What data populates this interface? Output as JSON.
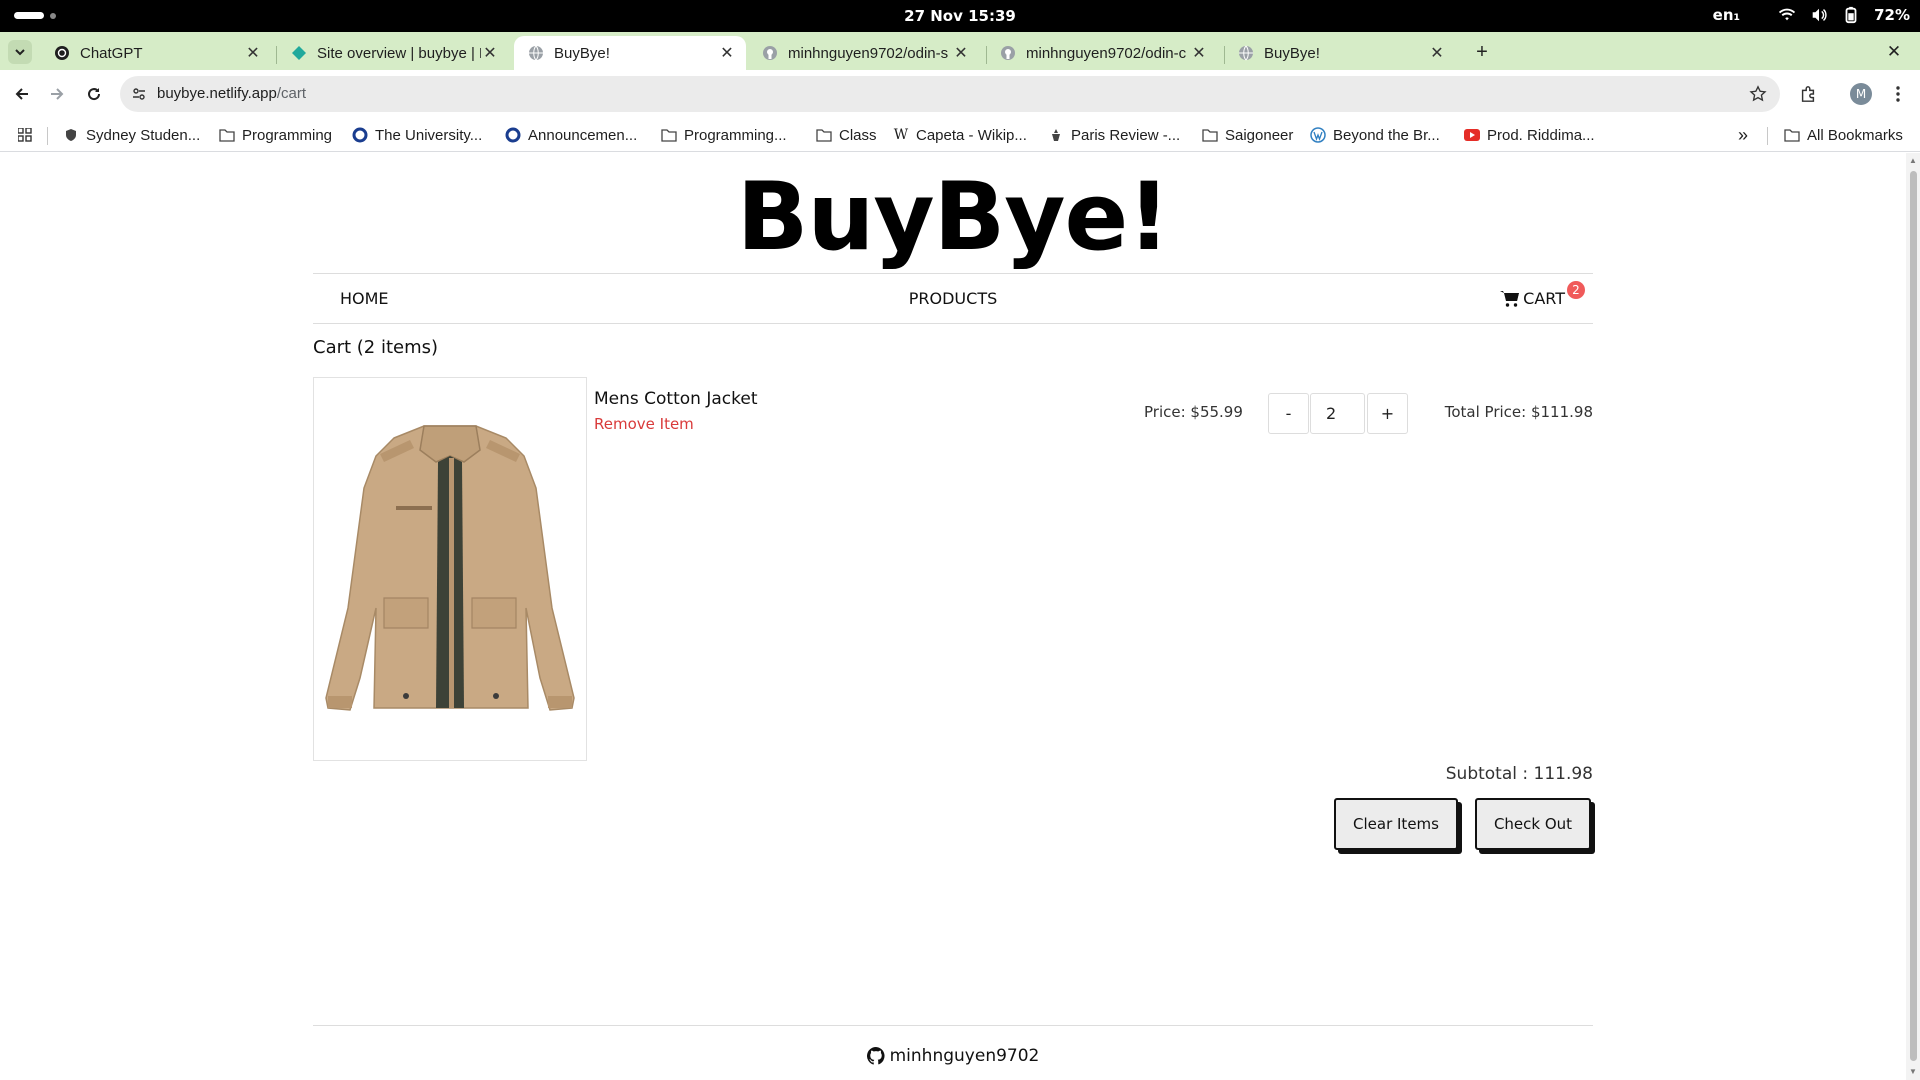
{
  "os": {
    "clock": "27 Nov  15:39",
    "language": "en₁",
    "battery": "72%"
  },
  "tabs": [
    {
      "title": "ChatGPT",
      "icon": "chatgpt-icon"
    },
    {
      "title": "Site overview | buybye | N",
      "icon": "netlify-icon"
    },
    {
      "title": "BuyBye!",
      "icon": "globe-icon",
      "active": true
    },
    {
      "title": "minhnguyen9702/odin-s",
      "icon": "github-icon"
    },
    {
      "title": "minhnguyen9702/odin-c",
      "icon": "github-icon"
    },
    {
      "title": "BuyBye!",
      "icon": "globe-icon"
    }
  ],
  "toolbar": {
    "url_host": "buybye.netlify.app",
    "url_path": "/cart",
    "avatar_initial": "M"
  },
  "bookmarks": [
    {
      "label": "Sydney Studen...",
      "icon": "shield-icon"
    },
    {
      "label": "Programming",
      "icon": "folder-icon"
    },
    {
      "label": "The University...",
      "icon": "circle-icon"
    },
    {
      "label": "Announcemen...",
      "icon": "circle-icon"
    },
    {
      "label": "Programming...",
      "icon": "folder-icon"
    },
    {
      "label": "Class",
      "icon": "folder-icon"
    },
    {
      "label": "Capeta - Wikip...",
      "icon": "wikipedia-icon"
    },
    {
      "label": "Paris Review -...",
      "icon": "paris-review-icon"
    },
    {
      "label": "Saigoneer",
      "icon": "folder-icon"
    },
    {
      "label": "Beyond the Br...",
      "icon": "wordpress-icon"
    },
    {
      "label": "Prod. Riddima...",
      "icon": "youtube-icon"
    }
  ],
  "bookmarks_overflow": "»",
  "all_bookmarks": "All Bookmarks",
  "site": {
    "brand": "BuyBye!",
    "nav": {
      "home": "HOME",
      "products": "PRODUCTS",
      "cart": "CART",
      "cart_count": "2"
    },
    "cart_heading": "Cart (2 items)",
    "item": {
      "name": "Mens Cotton Jacket",
      "remove": "Remove Item",
      "price": "Price: $55.99",
      "minus": "-",
      "quantity": "2",
      "plus": "+",
      "total": "Total Price: $111.98"
    },
    "subtotal": "Subtotal : 111.98",
    "clear_label": "Clear Items",
    "checkout_label": "Check Out",
    "footer_user": "minhnguyen9702"
  },
  "colors": {
    "tabstrip": "#d6ecc7",
    "remove_red": "#d93a3a",
    "badge_red": "#f05a5a",
    "jacket_tan": "#c9a984"
  }
}
